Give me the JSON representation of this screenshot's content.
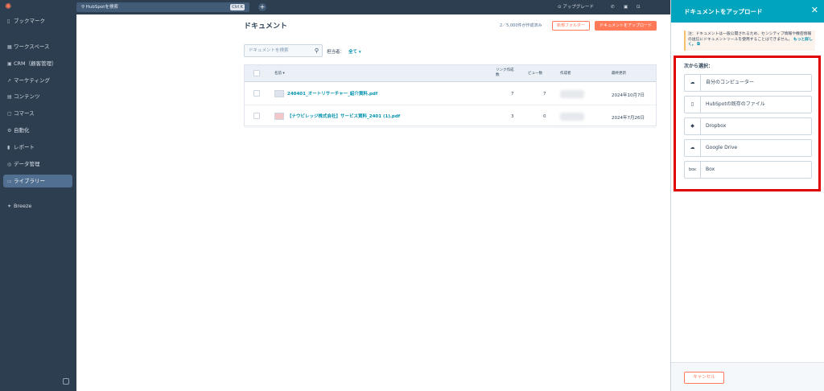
{
  "colors": {
    "accent": "#ff7a59",
    "panel_header": "#00a4bd",
    "sidebar": "#2d3e50",
    "link": "#0091ae",
    "highlight": "#e00000"
  },
  "sidebar": {
    "items": [
      {
        "icon": "bookmark-icon",
        "label": "ブックマーク"
      },
      {
        "icon": "workspace-icon",
        "label": "ワークスペース"
      },
      {
        "icon": "crm-icon",
        "label": "CRM（顧客管理）"
      },
      {
        "icon": "marketing-icon",
        "label": "マーケティング"
      },
      {
        "icon": "content-icon",
        "label": "コンテンツ"
      },
      {
        "icon": "commerce-icon",
        "label": "コマース"
      },
      {
        "icon": "automation-icon",
        "label": "自動化"
      },
      {
        "icon": "report-icon",
        "label": "レポート"
      },
      {
        "icon": "data-icon",
        "label": "データ管理"
      },
      {
        "icon": "library-icon",
        "label": "ライブラリー",
        "active": true
      }
    ],
    "breeze": "Breeze"
  },
  "topbar": {
    "search_placeholder": "HubSpotを検索",
    "shortcut": "Ctrl K",
    "upgrade": "アップグレード"
  },
  "main": {
    "title": "ドキュメント",
    "quota": "2／5,000件が作成済み",
    "new_folder": "新規フォルダー",
    "upload": "ドキュメントをアップロード",
    "search_placeholder": "ドキュメントを検索",
    "owner_label": "担当者：",
    "owner_value": "全て",
    "columns": {
      "name": "名前",
      "links": "リンク作成数",
      "views": "ビュー数",
      "creator": "作成者",
      "updated": "最終更新"
    },
    "rows": [
      {
        "name": "240401_オートリサーチャー_紹介資料.pdf",
        "links": "7",
        "views": "7",
        "updated": "2024年10月7日"
      },
      {
        "name": "【ナウビレッジ株式会社】サービス資料_2401 (1).pdf",
        "links": "3",
        "views": "0",
        "updated": "2024年7月26日"
      }
    ]
  },
  "panel": {
    "title": "ドキュメントをアップロード",
    "note": "注：ドキュメントは一般公開されるため、センシティブ情報や機密情報の送信にドキュメントツールを使用することはできません。",
    "note_link": "もっと詳しく。",
    "choose_label": "次から選択：",
    "sources": [
      {
        "icon": "cloud-upload-icon",
        "glyph": "☁",
        "label": "自分のコンピューター"
      },
      {
        "icon": "file-icon",
        "glyph": "▯",
        "label": "HubSpotの既存のファイル"
      },
      {
        "icon": "dropbox-icon",
        "glyph": "◆",
        "label": "Dropbox"
      },
      {
        "icon": "google-drive-icon",
        "glyph": "☁",
        "label": "Google Drive"
      },
      {
        "icon": "box-icon",
        "glyph": "box",
        "label": "Box"
      }
    ],
    "cancel": "キャンセル"
  }
}
